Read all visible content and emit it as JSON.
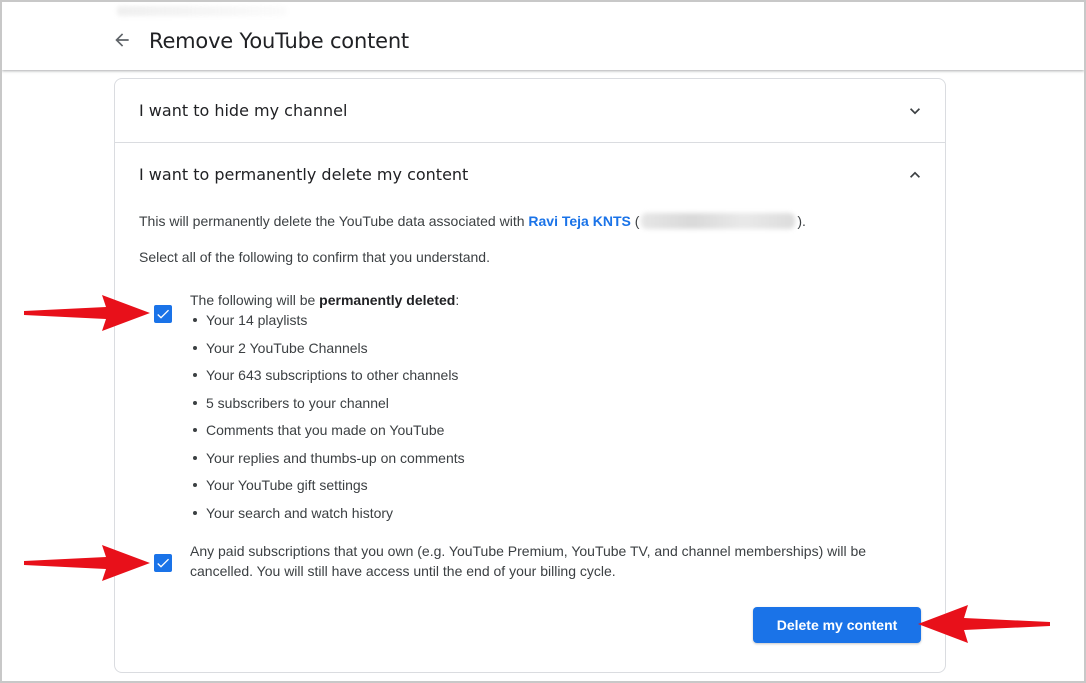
{
  "header": {
    "title": "Remove YouTube content"
  },
  "sections": {
    "hide": {
      "label": "I want to hide my channel",
      "state": "collapsed"
    },
    "delete": {
      "label": "I want to permanently delete my content",
      "state": "expanded",
      "description_prefix": "This will permanently delete the YouTube data associated with ",
      "account_name": "Ravi Teja KNTS",
      "description_suffix_open": " (",
      "description_suffix_close": ").",
      "confirm_text": "Select all of the following to confirm that you understand.",
      "checkbox_1": {
        "checked": true,
        "intro_prefix": "The following will be ",
        "intro_bold": "permanently deleted",
        "intro_suffix": ":",
        "items": [
          "Your 14 playlists",
          "Your 2 YouTube Channels",
          "Your 643 subscriptions to other channels",
          "5 subscribers to your channel",
          "Comments that you made on YouTube",
          "Your replies and thumbs-up on comments",
          "Your YouTube gift settings",
          "Your search and watch history"
        ]
      },
      "checkbox_2": {
        "checked": true,
        "text": "Any paid subscriptions that you own (e.g. YouTube Premium, YouTube TV, and channel memberships) will be cancelled. You will still have access until the end of your billing cycle."
      },
      "button_label": "Delete my content"
    }
  },
  "colors": {
    "accent": "#1a73e8",
    "annotation_arrow": "#e8101a",
    "divider": "#dadce0"
  },
  "icons": {
    "back": "arrow-back-icon",
    "collapsed": "chevron-down-icon",
    "expanded": "chevron-up-icon",
    "checkbox": "checkmark-icon",
    "annotation": "red-arrow-annotation"
  }
}
